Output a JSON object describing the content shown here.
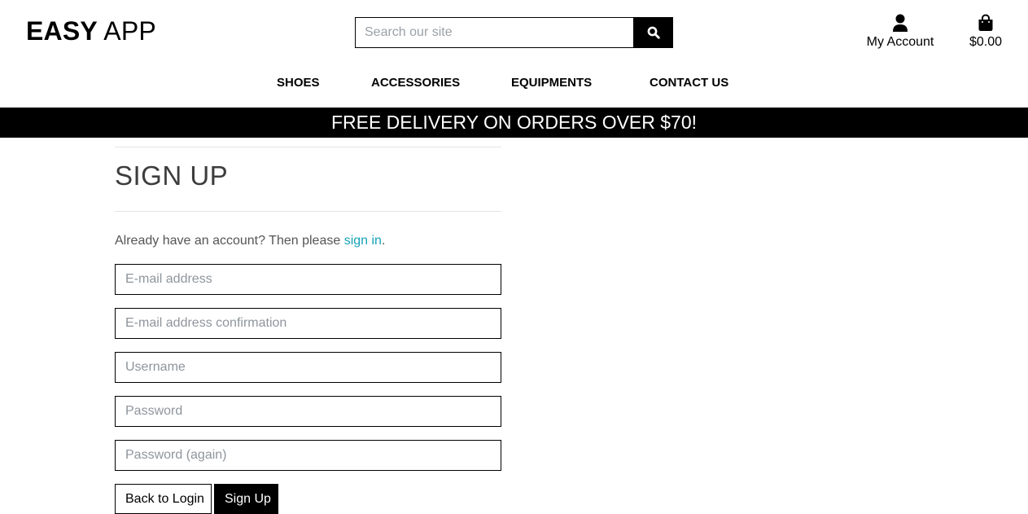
{
  "header": {
    "logo_bold": "EASY",
    "logo_rest": " APP",
    "search_placeholder": "Search our site",
    "account_label": "My Account",
    "cart_total": "$0.00"
  },
  "nav": {
    "items": [
      "SHOES",
      "ACCESSORIES",
      "EQUIPMENTS",
      "CONTACT US"
    ]
  },
  "banner": {
    "text": "FREE DELIVERY ON ORDERS OVER $70!"
  },
  "signup": {
    "title": "SIGN UP",
    "intro_prefix": "Already have an account? Then please ",
    "intro_link": "sign in",
    "intro_suffix": ".",
    "email_placeholder": "E-mail address",
    "email_confirm_placeholder": "E-mail address confirmation",
    "username_placeholder": "Username",
    "password_placeholder": "Password",
    "password_again_placeholder": "Password (again)",
    "back_label": "Back to Login",
    "submit_label": "Sign Up"
  },
  "icons": {
    "search": "search-icon",
    "account": "user-icon",
    "cart": "shopping-bag-icon"
  },
  "colors": {
    "primary": "#000000",
    "link": "#17a2b8",
    "banner_text": "#ffffff"
  }
}
